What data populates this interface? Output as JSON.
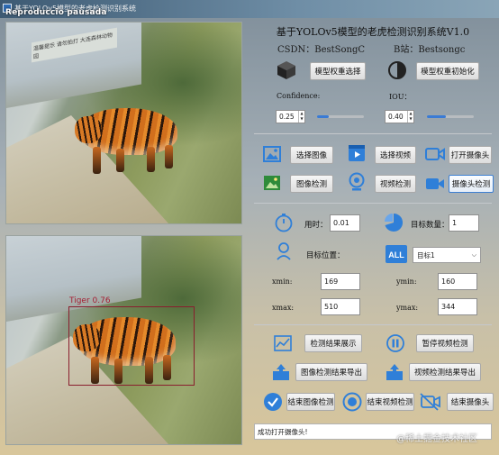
{
  "window": {
    "title": "基于YOLOv5模型的老虎检测识别系统",
    "overlay_text": "Reproduccio pausada"
  },
  "header": {
    "app_title": "基于YOLOv5模型的老虎检测识别系统V1.0",
    "csdn": "CSDN：BestSongC",
    "bilibili": "B站：Bestsongc"
  },
  "model": {
    "select_button": "模型权重选择",
    "init_button": "模型权重初始化"
  },
  "params": {
    "confidence_label": "Confidence:",
    "confidence_value": "0.25",
    "confidence_level": 0.25,
    "iou_label": "IOU：",
    "iou_value": "0.40",
    "iou_level": 0.4
  },
  "sources": {
    "select_image": "选择图像",
    "select_video": "选择视频",
    "open_camera": "打开摄像头",
    "image_detect": "图像检测",
    "video_detect": "视频检测",
    "camera_detect": "摄像头检测"
  },
  "results": {
    "time_label": "用时：",
    "time_value": "0.01",
    "count_label": "目标数量：",
    "count_value": "1",
    "position_label": "目标位置：",
    "target_selected": "目标1",
    "xmin_label": "xmin:",
    "xmin_value": "169",
    "ymin_label": "ymin:",
    "ymin_value": "160",
    "xmax_label": "xmax:",
    "xmax_value": "510",
    "ymax_label": "ymax:",
    "ymax_value": "344"
  },
  "actions": {
    "show_results": "检测结果展示",
    "pause_video": "暂停视频检测",
    "export_image": "图像检测结果导出",
    "export_video": "视频检测结果导出",
    "end_image": "结束图像检测",
    "end_video": "结束视频检测",
    "end_camera": "结束摄像头"
  },
  "detection": {
    "label": "Tiger  0.76"
  },
  "image_top": {
    "sign_text": "温馨提示 请勿拍打 大连森林动物园"
  },
  "status": {
    "message": "成功打开摄像头!"
  },
  "watermark": "@稀土掘金技术社区",
  "colors": {
    "accent": "#3a7bd5",
    "bbox": "#8a1e2e"
  }
}
